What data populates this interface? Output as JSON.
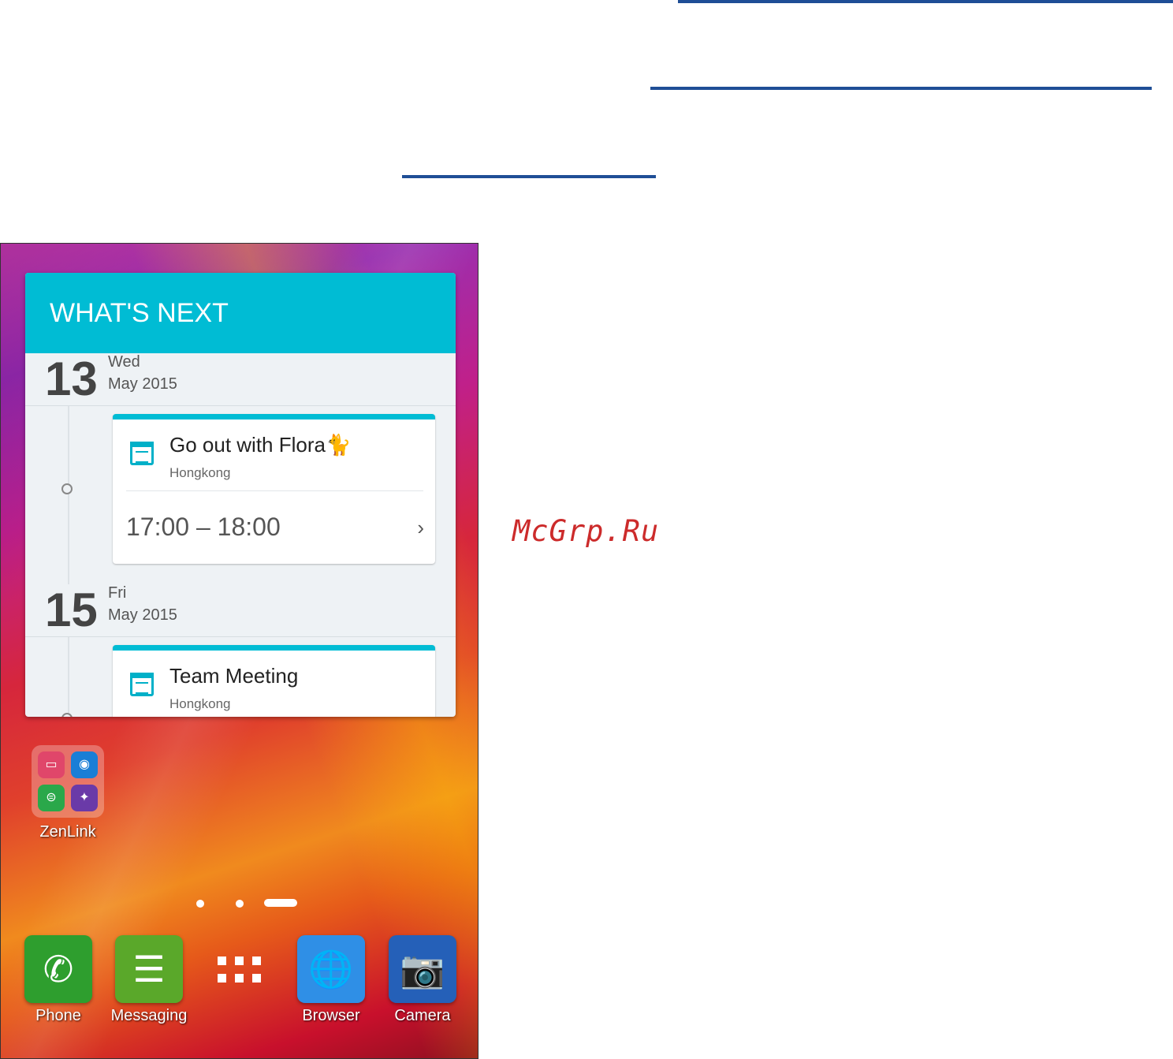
{
  "watermark": "McGrp.Ru",
  "widget": {
    "header": "WHAT'S NEXT",
    "days": [
      {
        "day_num": "13",
        "weekday": "Wed",
        "month_year": "May 2015",
        "event": {
          "title": "Go out with Flora🐈",
          "location": "Hongkong",
          "time": "17:00 – 18:00",
          "chevron": "›"
        }
      },
      {
        "day_num": "15",
        "weekday": "Fri",
        "month_year": "May 2015",
        "event": {
          "title": "Team Meeting",
          "location": "Hongkong"
        }
      }
    ]
  },
  "folder": {
    "label": "ZenLink",
    "apps": [
      "share-link-icon",
      "remote-link-icon",
      "pc-link-icon",
      "party-link-icon"
    ]
  },
  "page_indicator": {
    "count": 3,
    "active": 3
  },
  "dock": [
    {
      "label": "Phone",
      "icon": "phone-icon",
      "color": "#2e9e2e",
      "glyph": "✆"
    },
    {
      "label": "Messaging",
      "icon": "message-icon",
      "color": "#5aa82a",
      "glyph": "☰"
    },
    {
      "label": "",
      "icon": "all-apps-icon"
    },
    {
      "label": "Browser",
      "icon": "globe-icon",
      "color": "#2f8fe6",
      "glyph": "🌐"
    },
    {
      "label": "Camera",
      "icon": "camera-icon",
      "color": "#2560b8",
      "glyph": "📷"
    }
  ],
  "colors": {
    "accent": "#00bcd4",
    "rule": "#1f4e96",
    "watermark": "#cc2b2b"
  }
}
